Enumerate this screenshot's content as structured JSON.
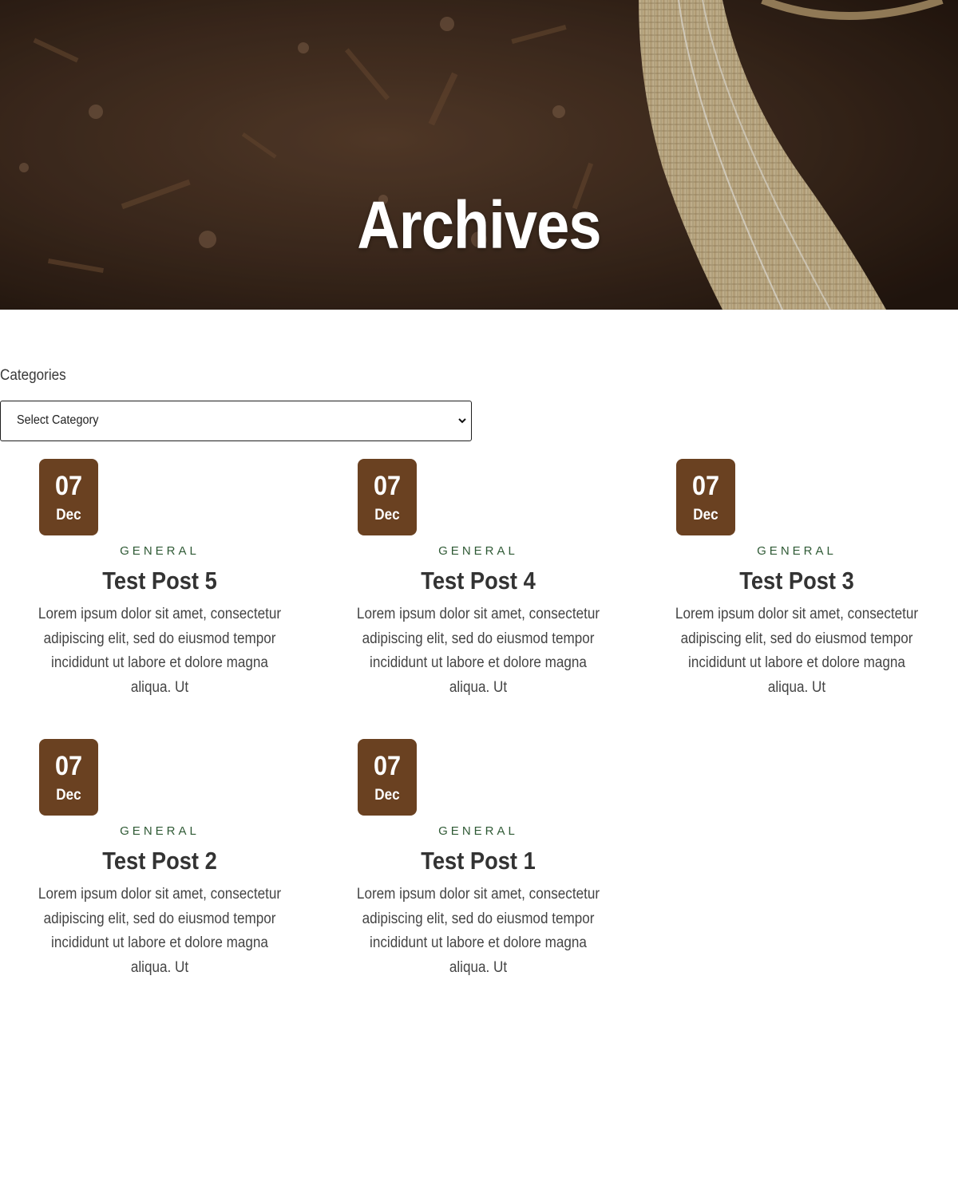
{
  "hero": {
    "title": "Archives"
  },
  "sidebar": {
    "categories_label": "Categories",
    "category_select": {
      "selected": "Select Category"
    }
  },
  "posts": [
    {
      "day": "07",
      "month": "Dec",
      "category": "GENERAL",
      "title": "Test Post 5",
      "excerpt": "Lorem ipsum dolor sit amet, consectetur adipiscing elit, sed do eiusmod tempor incididunt ut labore et dolore magna aliqua. Ut"
    },
    {
      "day": "07",
      "month": "Dec",
      "category": "GENERAL",
      "title": "Test Post 4",
      "excerpt": "Lorem ipsum dolor sit amet, consectetur adipiscing elit, sed do eiusmod tempor incididunt ut labore et dolore magna aliqua. Ut"
    },
    {
      "day": "07",
      "month": "Dec",
      "category": "GENERAL",
      "title": "Test Post 3",
      "excerpt": "Lorem ipsum dolor sit amet, consectetur adipiscing elit, sed do eiusmod tempor incididunt ut labore et dolore magna aliqua. Ut"
    },
    {
      "day": "07",
      "month": "Dec",
      "category": "GENERAL",
      "title": "Test Post 2",
      "excerpt": "Lorem ipsum dolor sit amet, consectetur adipiscing elit, sed do eiusmod tempor incididunt ut labore et dolore magna aliqua. Ut"
    },
    {
      "day": "07",
      "month": "Dec",
      "category": "GENERAL",
      "title": "Test Post 1",
      "excerpt": "Lorem ipsum dolor sit amet, consectetur adipiscing elit, sed do eiusmod tempor incididunt ut labore et dolore magna aliqua. Ut"
    }
  ],
  "colors": {
    "date_badge": "#6a4121",
    "category_text": "#2f5a35",
    "title_text": "#333333"
  }
}
